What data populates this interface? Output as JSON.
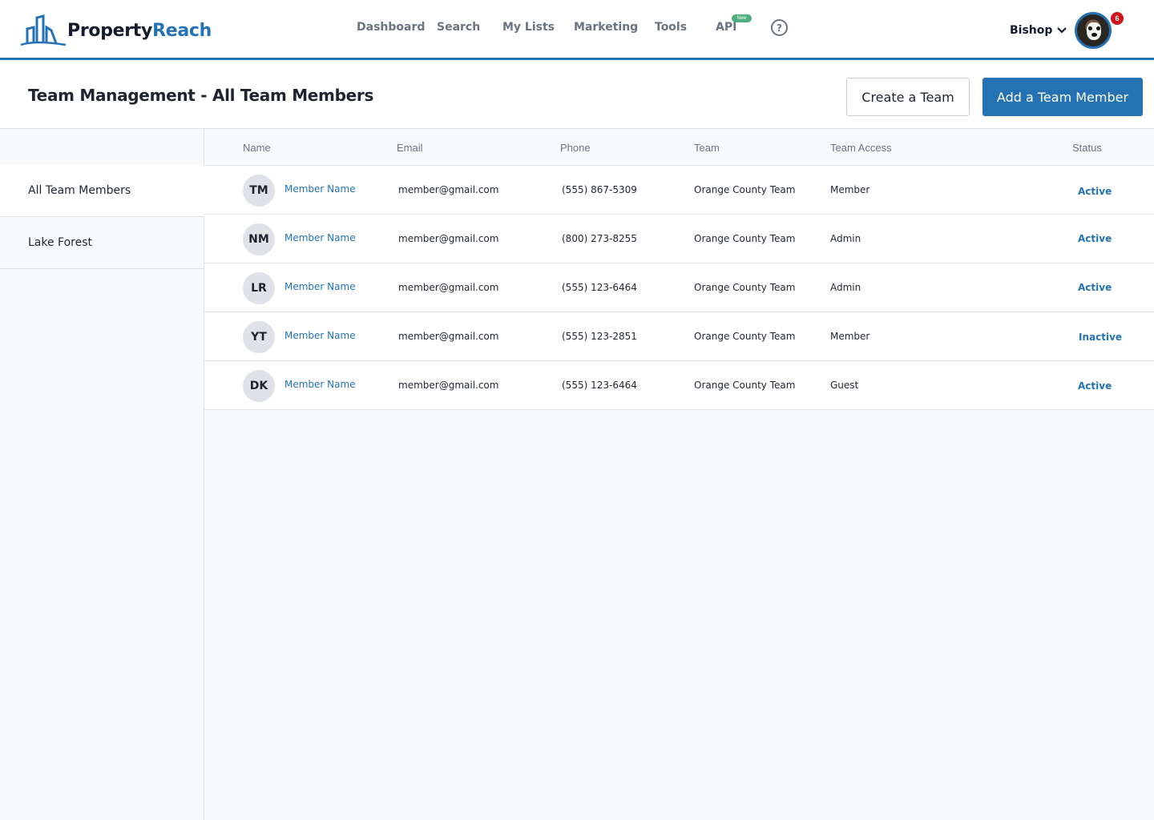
{
  "brand": {
    "name_part1": "Property",
    "name_part2": "Reach",
    "accent": "#2472b3"
  },
  "nav": {
    "items": [
      "Dashboard",
      "Search",
      "My Lists",
      "Marketing",
      "Tools",
      "API"
    ],
    "api_badge": "New",
    "help_icon": "help-circle-icon"
  },
  "user": {
    "name": "Bishop",
    "notifications": "6"
  },
  "page": {
    "title": "Team Management - All Team Members",
    "create_team_label": "Create a Team",
    "add_member_label": "Add a Team Member"
  },
  "sidebar": {
    "items": [
      "All Team Members",
      "Lake Forest"
    ],
    "active": "All Team Members"
  },
  "table": {
    "columns": [
      "Name",
      "Email",
      "Phone",
      "Team",
      "Team Access",
      "Status"
    ],
    "rows": [
      {
        "initials": "TM",
        "name": "Member Name",
        "email": "member@gmail.com",
        "phone": "(555) 867-5309",
        "team": "Orange County Team",
        "access": "Member",
        "status": "Active"
      },
      {
        "initials": "NM",
        "name": "Member Name",
        "email": "member@gmail.com",
        "phone": "(800) 273-8255",
        "team": "Orange County Team",
        "access": "Admin",
        "status": "Active"
      },
      {
        "initials": "LR",
        "name": "Member Name",
        "email": "member@gmail.com",
        "phone": "(555) 123-6464",
        "team": "Orange County Team",
        "access": "Admin",
        "status": "Active"
      },
      {
        "initials": "YT",
        "name": "Member Name",
        "email": "member@gmail.com",
        "phone": "(555) 123-2851",
        "team": "Orange County Team",
        "access": "Member",
        "status": "Inactive"
      },
      {
        "initials": "DK",
        "name": "Member Name",
        "email": "member@gmail.com",
        "phone": "(555) 123-6464",
        "team": "Orange County Team",
        "access": "Guest",
        "status": "Active"
      }
    ]
  }
}
